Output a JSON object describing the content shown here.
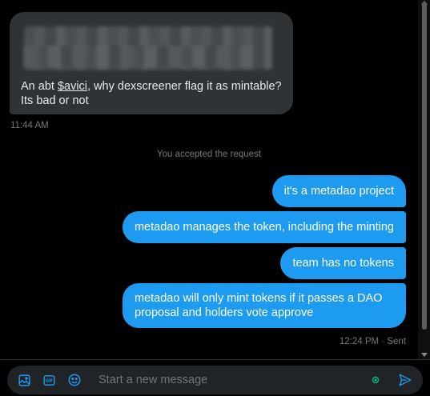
{
  "incoming_message": {
    "text_before": "An abt ",
    "cashtag": "$avici",
    "text_after": ", why dexscreener flag it as mintable? Its bad or not",
    "timestamp": "11:44 AM"
  },
  "system_note": "You accepted the request",
  "outgoing_messages": [
    {
      "text": "it's a metadao project"
    },
    {
      "text": "metadao manages the token, including the minting"
    },
    {
      "text": "team has no tokens"
    },
    {
      "text": "metadao will only mint tokens if it passes a DAO proposal and holders vote approve"
    }
  ],
  "outgoing_status": "12:24 PM · Sent",
  "composer": {
    "placeholder": "Start a new message"
  },
  "icons": {
    "image": "image-icon",
    "gif": "gif-icon",
    "emoji": "emoji-icon",
    "status": "status-dot-icon",
    "send": "send-icon"
  },
  "colors": {
    "accent": "#1d9bf0",
    "incoming_bubble": "#2f3336",
    "background": "#000000",
    "muted_text": "#71767b",
    "status_dot": "#00ba7c"
  }
}
